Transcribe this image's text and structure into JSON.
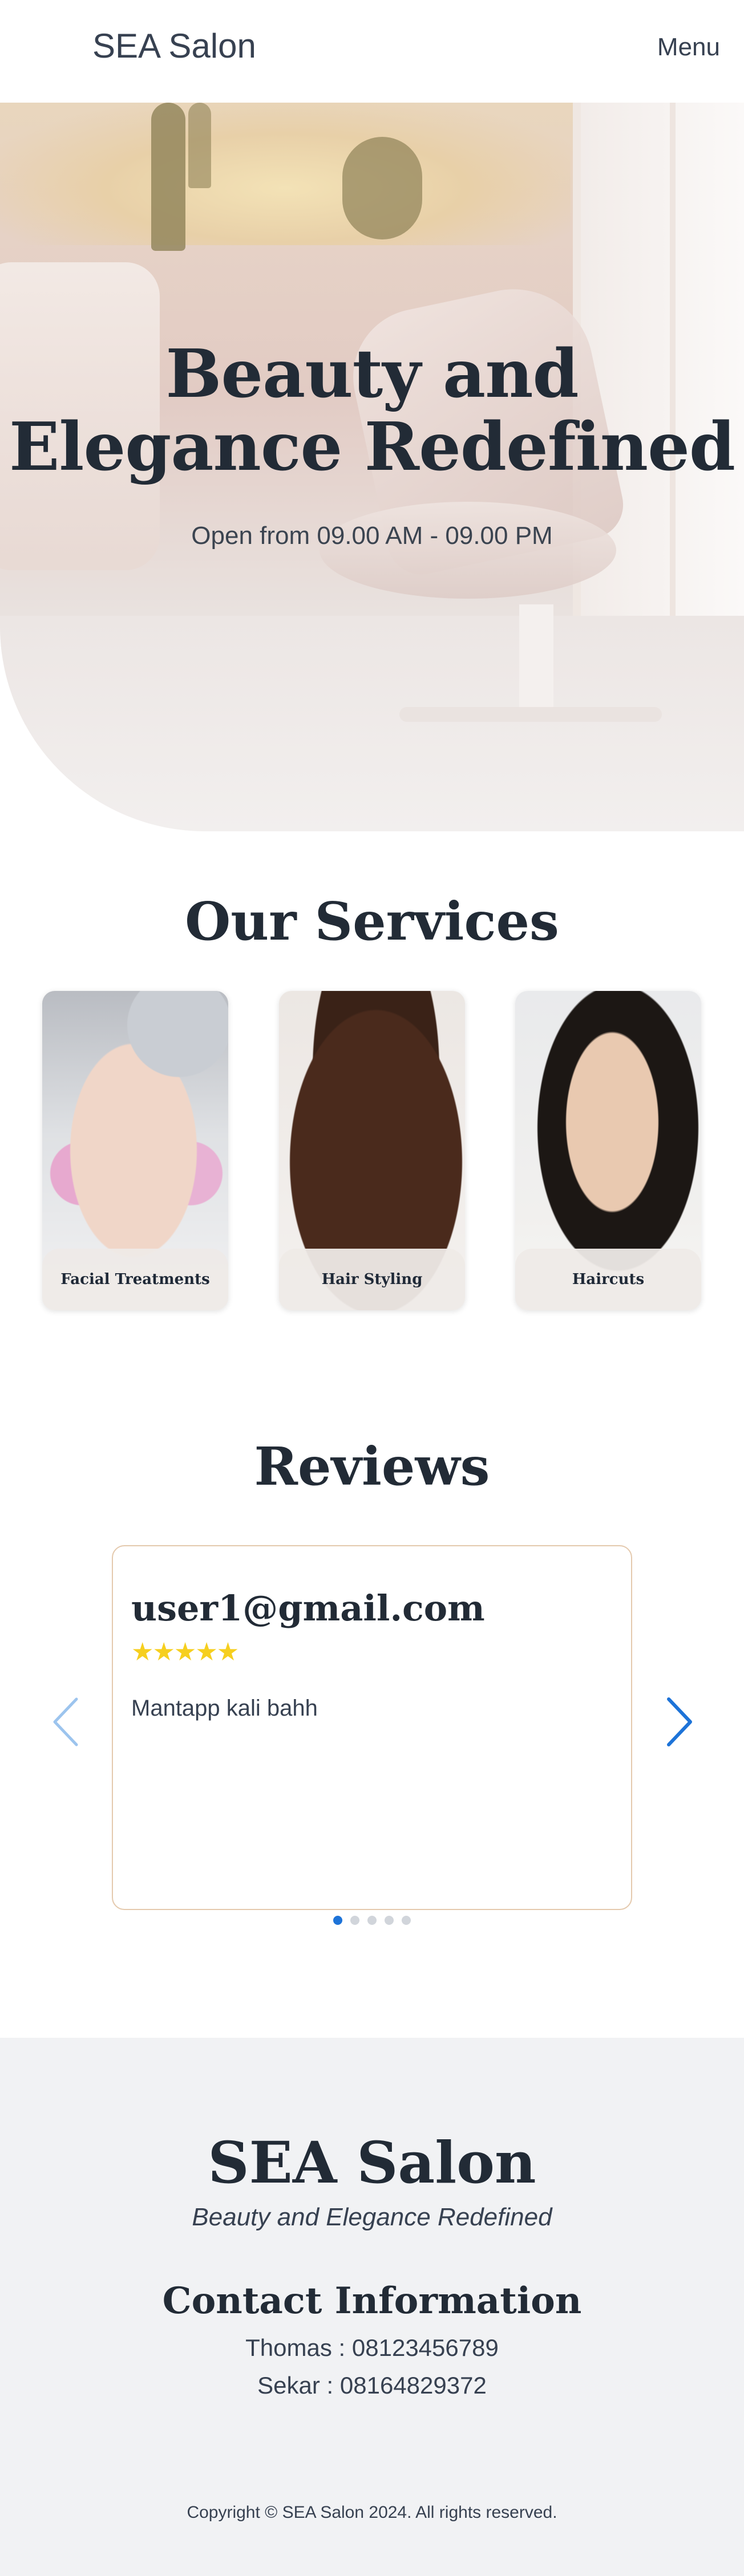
{
  "header": {
    "brand": "SEA Salon",
    "menu_label": "Menu"
  },
  "hero": {
    "title_line1": "Beauty and",
    "title_line2": "Elegance Redefined",
    "subtitle": "Open from 09.00 AM - 09.00 PM"
  },
  "services": {
    "title": "Our Services",
    "items": [
      {
        "label": "Facial Treatments"
      },
      {
        "label": "Hair Styling"
      },
      {
        "label": "Haircuts"
      }
    ]
  },
  "reviews": {
    "title": "Reviews",
    "current": {
      "user": "user1@gmail.com",
      "stars": "★★★★★",
      "rating": 5,
      "text": "Mantapp kali bahh"
    },
    "slide_count": 5,
    "active_slide": 1
  },
  "footer": {
    "brand": "SEA Salon",
    "tagline": "Beauty and Elegance Redefined",
    "contact_title": "Contact Information",
    "contacts": [
      {
        "line": "Thomas : 08123456789"
      },
      {
        "line": "Sekar : 08164829372"
      }
    ],
    "copyright": "Copyright © SEA Salon 2024. All rights reserved."
  },
  "colors": {
    "heading": "#222b36",
    "accent_blue": "#1d73d8",
    "star_yellow": "#f6cf1f",
    "review_border": "#e4c9ad",
    "footer_bg": "#f1f2f4"
  }
}
